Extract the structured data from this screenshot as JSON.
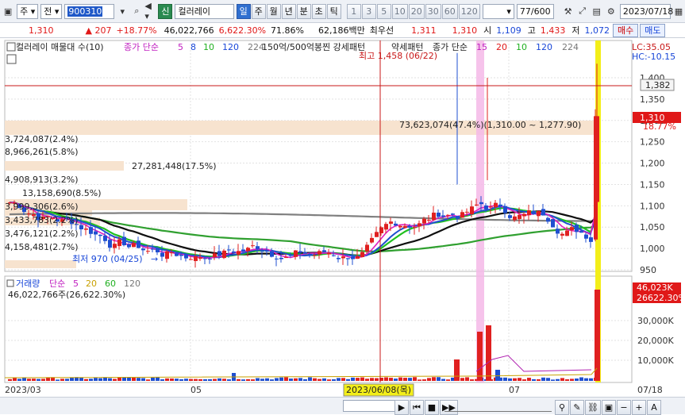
{
  "toolbar": {
    "market_select": "주",
    "period_select": "전",
    "stock_code": "900310",
    "tag": "신",
    "stock_name": "컬러레이",
    "tabs": [
      "일",
      "주",
      "월",
      "년",
      "분",
      "초",
      "틱"
    ],
    "active_tab": "일",
    "numbers": [
      "1",
      "3",
      "5",
      "10",
      "20",
      "30",
      "60",
      "120"
    ],
    "count_value": "77",
    "count_total": "/600",
    "date_value": "2023/07/18"
  },
  "infobar": {
    "price": "1,310",
    "change": "▲ 207",
    "change_rate": "+18.77%",
    "volume": "46,022,766",
    "volume_rate": "6,622.30%",
    "turnover": "71.86%",
    "amount": "62,186백만",
    "best_ask_label": "최우선",
    "best_ask": "1,311",
    "best_bid": "1,310",
    "open_label": "시",
    "open": "1,109",
    "high_label": "고",
    "high": "1,433",
    "low_label": "저",
    "low": "1,072",
    "buy_label": "매수",
    "sell_label": "매도"
  },
  "legend_price": {
    "name": "컬러레이 매물대 수(10)",
    "ma_label": "종가 단순",
    "ma_periods": [
      "5",
      "8",
      "10",
      "120",
      "224"
    ],
    "signal1": "150억/500억봉찐 강세패턴",
    "signal2": "약세패턴",
    "ma2_label": "종가 단순",
    "ma2_periods": [
      "15",
      "20",
      "10",
      "120",
      "224"
    ]
  },
  "legend_volume": {
    "name": "거래량",
    "ma_label": "단순",
    "ma_periods": [
      "5",
      "20",
      "60",
      "120"
    ],
    "volume_text": "46,022,766주(26,622.30%)"
  },
  "annotations": {
    "high": "최고 1,458 (06/22)",
    "low": "최저 970 (04/25)",
    "lc": "LC:35.05",
    "hc": "HC:-10.15",
    "crosshair_price": "1,382",
    "current_price": "1,310",
    "current_rate": "18.77%",
    "volume_tag": "46,023K",
    "volume_tag2": "26622.30%",
    "crosshair_date": "2023/06/08(목)"
  },
  "volume_profile": [
    "73,623,074(47.4%)(1,310.00 ~ 1,277.90)",
    "3,724,087(2.4%)",
    "8,966,261(5.8%)",
    "27,281,448(17.5%)",
    "4,908,913(3.2%)",
    "13,158,690(8.5%)",
    "3,999,306(2.6%)",
    "3,433,783(2.2%)",
    "3,476,121(2.2%)",
    "4,158,481(2.7%)"
  ],
  "chart_data": {
    "type": "candlestick",
    "price_axis": [
      "1,400",
      "1,350",
      "1,300",
      "1,250",
      "1,200",
      "1,150",
      "1,100",
      "1,050",
      "1,000",
      "950"
    ],
    "volume_axis": [
      "30,000K",
      "20,000K",
      "10,000K"
    ],
    "x_axis": [
      "2023/03",
      "05",
      "06",
      "07",
      "07/18"
    ]
  },
  "colors": {
    "up": "#e02020",
    "down": "#1f4fd0",
    "ma5": "#e020c0",
    "ma8": "#1f4fd0",
    "ma10": "#20c020",
    "ma120": "#102080",
    "ma224": "#808080",
    "accent": "#2f6fd0"
  }
}
